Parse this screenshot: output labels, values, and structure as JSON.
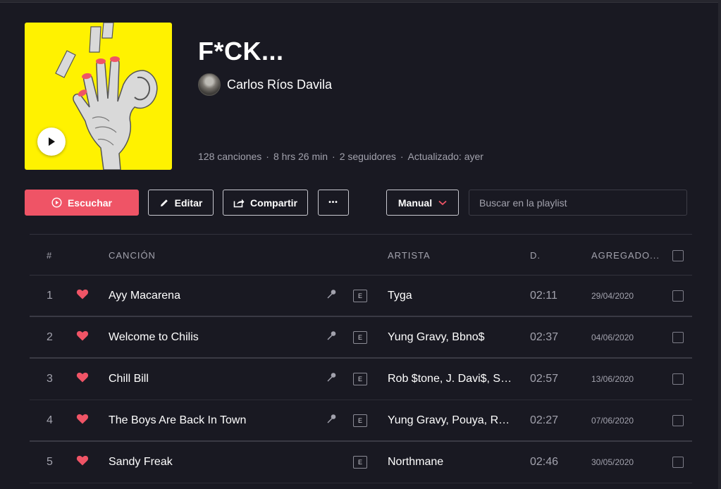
{
  "playlist": {
    "title": "F*CK...",
    "owner": "Carlos Ríos Davila",
    "meta": {
      "songs": "128 canciones",
      "duration": "8 hrs 26 min",
      "followers": "2 seguidores",
      "updated": "Actualizado: ayer"
    }
  },
  "toolbar": {
    "play_label": "Escuchar",
    "edit_label": "Editar",
    "share_label": "Compartir",
    "more_label": "•••",
    "sort_label": "Manual",
    "search_placeholder": "Buscar en la playlist"
  },
  "colors": {
    "accent": "#ef5466",
    "background": "#191922",
    "cover_yellow": "#fff200"
  },
  "table": {
    "headers": {
      "num": "#",
      "song": "CANCIÓN",
      "artist": "ARTISTA",
      "duration": "D.",
      "added": "AGREGADO..."
    },
    "rows": [
      {
        "num": "1",
        "song": "Ayy Macarena",
        "lyrics": true,
        "explicit": "E",
        "artist": "Tyga",
        "duration": "02:11",
        "added": "29/04/2020"
      },
      {
        "num": "2",
        "song": "Welcome to Chilis",
        "lyrics": true,
        "explicit": "E",
        "artist": "Yung Gravy, Bbno$",
        "duration": "02:37",
        "added": "04/06/2020"
      },
      {
        "num": "3",
        "song": "Chill Bill",
        "lyrics": true,
        "explicit": "E",
        "artist": "Rob $tone, J. Davi$, Spooks",
        "duration": "02:57",
        "added": "13/06/2020"
      },
      {
        "num": "4",
        "song": "The Boys Are Back In Town",
        "lyrics": true,
        "explicit": "E",
        "artist": "Yung Gravy, Pouya, Ramirez",
        "duration": "02:27",
        "added": "07/06/2020"
      },
      {
        "num": "5",
        "song": "Sandy Freak",
        "lyrics": false,
        "explicit": "E",
        "artist": "Northmane",
        "duration": "02:46",
        "added": "30/05/2020"
      }
    ]
  }
}
